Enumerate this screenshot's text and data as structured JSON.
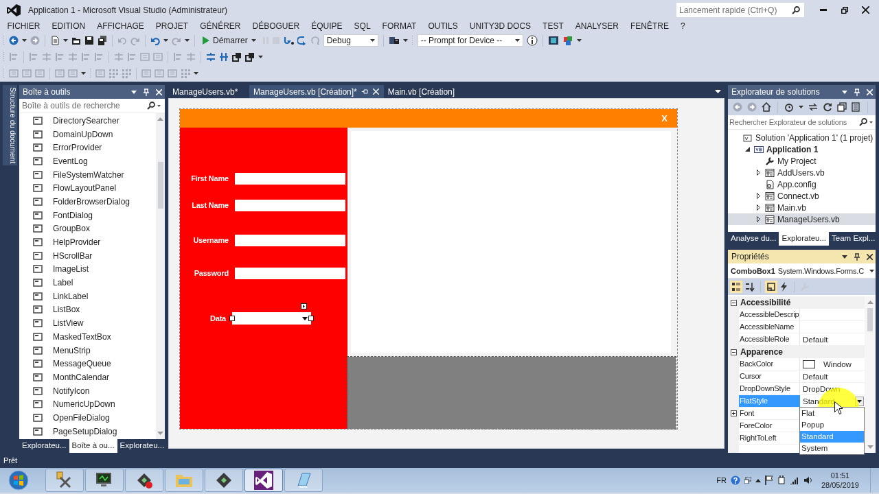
{
  "window": {
    "title": "Application 1 - Microsoft Visual Studio (Administrateur)",
    "quick_launch": {
      "placeholder": "Lancement rapide (Ctrl+Q)"
    }
  },
  "menu": [
    "FICHIER",
    "EDITION",
    "AFFICHAGE",
    "PROJET",
    "GÉNÉRER",
    "DÉBOGUER",
    "ÉQUIPE",
    "SQL",
    "FORMAT",
    "OUTILS",
    "UNITY3D DOCS",
    "TEST",
    "ANALYSER",
    "FENÊTRE",
    "?"
  ],
  "toolbar": {
    "start": "Démarrer",
    "configuration": "Debug",
    "device": "-- Prompt for Device --"
  },
  "side_tabs": [
    "Structure du document"
  ],
  "toolbox": {
    "title": "Boîte à outils",
    "search": {
      "placeholder": "Boîte à outils de recherche"
    },
    "items": [
      "DirectorySearcher",
      "DomainUpDown",
      "ErrorProvider",
      "EventLog",
      "FileSystemWatcher",
      "FlowLayoutPanel",
      "FolderBrowserDialog",
      "FontDialog",
      "GroupBox",
      "HelpProvider",
      "HScrollBar",
      "ImageList",
      "Label",
      "LinkLabel",
      "ListBox",
      "ListView",
      "MaskedTextBox",
      "MenuStrip",
      "MessageQueue",
      "MonthCalendar",
      "NotifyIcon",
      "NumericUpDown",
      "OpenFileDialog",
      "PageSetupDialog"
    ],
    "tabs": [
      {
        "label": "Explorateu...",
        "selected": false
      },
      {
        "label": "Boîte à ou...",
        "selected": true
      },
      {
        "label": "Explorateu...",
        "selected": false
      }
    ]
  },
  "documents": {
    "tabs": [
      {
        "label": "ManageUsers.vb*",
        "selected": false
      },
      {
        "label": "ManageUsers.vb [Création]*",
        "selected": true
      },
      {
        "label": "Main.vb [Création]",
        "selected": false
      }
    ]
  },
  "form": {
    "close": "X",
    "fields": [
      {
        "label": "First Name",
        "kind": "text"
      },
      {
        "label": "Last Name",
        "kind": "text"
      },
      {
        "label": "Username",
        "kind": "text"
      },
      {
        "label": "Password",
        "kind": "text"
      },
      {
        "label": "Data",
        "kind": "combo"
      }
    ]
  },
  "solution_explorer": {
    "title": "Explorateur de solutions",
    "search": {
      "placeholder": "Rechercher Explorateur de solutions"
    },
    "tree": [
      {
        "label": "Solution 'Application 1' (1 projet)",
        "kind": "solution",
        "selected": false,
        "children": [
          {
            "label": "Application 1",
            "kind": "project",
            "expanded": true,
            "selected": false,
            "children": [
              {
                "label": "My Project",
                "kind": "wrench",
                "selected": false
              },
              {
                "label": "AddUsers.vb",
                "kind": "form",
                "expanded": false,
                "selected": false
              },
              {
                "label": "App.config",
                "kind": "config",
                "selected": false
              },
              {
                "label": "Connect.vb",
                "kind": "form",
                "expanded": false,
                "selected": false
              },
              {
                "label": "Main.vb",
                "kind": "form",
                "expanded": false,
                "selected": false
              },
              {
                "label": "ManageUsers.vb",
                "kind": "form",
                "expanded": false,
                "selected": true
              }
            ]
          }
        ]
      }
    ],
    "tabs": [
      {
        "label": "Analyse du...",
        "selected": false
      },
      {
        "label": "Explorateu...",
        "selected": true
      },
      {
        "label": "Team Expl...",
        "selected": false
      }
    ]
  },
  "properties": {
    "title": "Propriétés",
    "object": {
      "name": "ComboBox1",
      "type": "System.Windows.Forms.C"
    },
    "categories": [
      {
        "name": "Accessibilité",
        "expanded": true,
        "rows": [
          {
            "name": "AccessibleDescrip",
            "selected": false
          },
          {
            "name": "AccessibleName",
            "selected": false
          },
          {
            "name": "AccessibleRole",
            "value": "Default",
            "selected": false
          }
        ]
      },
      {
        "name": "Apparence",
        "expanded": true,
        "rows": [
          {
            "name": "BackColor",
            "value": "Window",
            "color": "#ffffff",
            "selected": false
          },
          {
            "name": "Cursor",
            "value": "Default",
            "selected": false
          },
          {
            "name": "DropDownStyle",
            "value": "DropDown",
            "selected": false
          },
          {
            "name": "FlatStyle",
            "value": "Standard",
            "selected": true,
            "dropdown": [
              {
                "label": "Flat",
                "selected": false
              },
              {
                "label": "Popup",
                "selected": false
              },
              {
                "label": "Standard",
                "selected": true
              },
              {
                "label": "System",
                "selected": false
              }
            ]
          },
          {
            "name": "Font",
            "expanded": false,
            "selected": false
          },
          {
            "name": "ForeColor",
            "selected": false
          },
          {
            "name": "RightToLeft",
            "selected": false
          }
        ]
      }
    ]
  },
  "status_bar": "Prêt",
  "taskbar": {
    "apps": [
      {
        "kind": "tools",
        "selected": false
      },
      {
        "kind": "monitor",
        "selected": false
      },
      {
        "kind": "record",
        "selected": false
      },
      {
        "kind": "folder",
        "selected": false
      },
      {
        "kind": "terminal",
        "selected": false
      },
      {
        "kind": "studio",
        "selected": true
      },
      {
        "kind": "notepad",
        "selected": false
      }
    ],
    "language": "FR",
    "time": "01:51",
    "date": "28/05/2019"
  }
}
